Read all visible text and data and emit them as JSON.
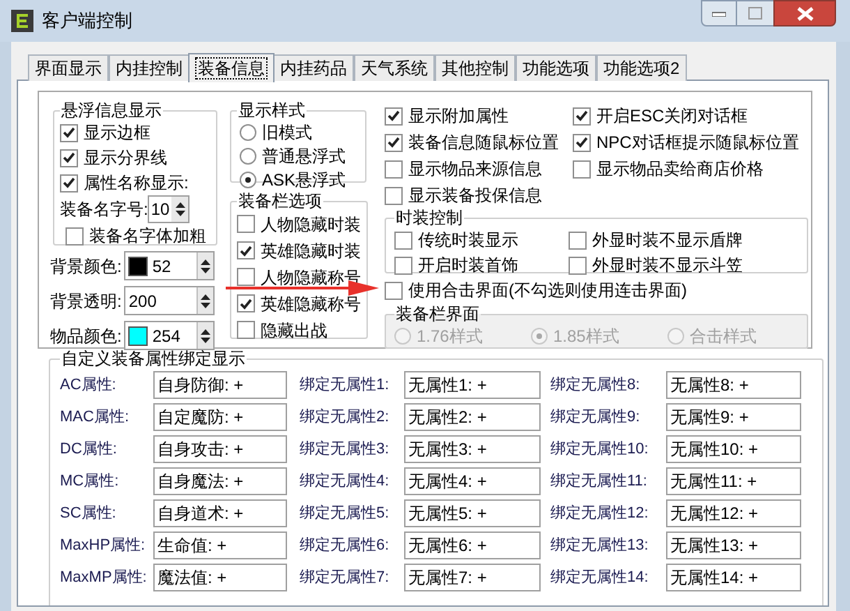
{
  "window": {
    "title": "客户端控制"
  },
  "tabs": [
    {
      "label": "界面显示",
      "selected": false
    },
    {
      "label": "内挂控制",
      "selected": false
    },
    {
      "label": "装备信息",
      "selected": true
    },
    {
      "label": "内挂药品",
      "selected": false
    },
    {
      "label": "天气系统",
      "selected": false
    },
    {
      "label": "其他控制",
      "selected": false
    },
    {
      "label": "功能选项",
      "selected": false
    },
    {
      "label": "功能选项2",
      "selected": false
    }
  ],
  "float_info": {
    "title": "悬浮信息显示",
    "checkboxes": [
      {
        "label": "显示边框",
        "checked": true
      },
      {
        "label": "显示分界线",
        "checked": true
      },
      {
        "label": "属性名称显示:",
        "checked": true
      }
    ],
    "font_size": {
      "label": "装备名字号:",
      "value": "10"
    },
    "bold": {
      "label": "装备名字体加粗",
      "checked": false
    }
  },
  "color_settings": [
    {
      "kind": "color",
      "label": "背景颜色:",
      "value": "52",
      "color": "#000000"
    },
    {
      "kind": "number",
      "label": "背景透明:",
      "value": "200"
    },
    {
      "kind": "color",
      "label": "物品颜色:",
      "value": "254",
      "color": "#00ffff"
    }
  ],
  "display_style": {
    "title": "显示样式",
    "options": [
      {
        "label": "旧模式",
        "selected": false
      },
      {
        "label": "普通悬浮式",
        "selected": false
      },
      {
        "label": "ASK悬浮式",
        "selected": true
      }
    ]
  },
  "equip_bar_options": {
    "title": "装备栏选项",
    "checkboxes": [
      {
        "label": "人物隐藏时装",
        "checked": false
      },
      {
        "label": "英雄隐藏时装",
        "checked": true
      },
      {
        "label": "人物隐藏称号",
        "checked": false
      },
      {
        "label": "英雄隐藏称号",
        "checked": true
      },
      {
        "label": "隐藏出战",
        "checked": false
      }
    ]
  },
  "options": [
    {
      "label": "显示附加属性",
      "checked": true
    },
    {
      "label": "开启ESC关闭对话框",
      "checked": true
    },
    {
      "label": "装备信息随鼠标位置",
      "checked": true
    },
    {
      "label": "NPC对话框提示随鼠标位置",
      "checked": true
    },
    {
      "label": "显示物品来源信息",
      "checked": false
    },
    {
      "label": "显示物品卖给商店价格",
      "checked": false
    },
    {
      "label": "显示装备投保信息",
      "checked": false
    }
  ],
  "fashion_control": {
    "title": "时装控制",
    "checkboxes": [
      {
        "label": "传统时装显示",
        "checked": false
      },
      {
        "label": "外显时装不显示盾牌",
        "checked": false
      },
      {
        "label": "开启时装首饰",
        "checked": false
      },
      {
        "label": "外显时装不显示斗笠",
        "checked": false
      }
    ]
  },
  "combo_ui": {
    "label": "使用合击界面(不勾选则使用连击界面)",
    "checked": false
  },
  "equip_bar_ui": {
    "title": "装备栏界面",
    "disabled": true,
    "options": [
      {
        "label": "1.76样式",
        "selected": false
      },
      {
        "label": "1.85样式",
        "selected": true
      },
      {
        "label": "合击样式",
        "selected": false
      }
    ]
  },
  "attribute_binding": {
    "title": "自定义装备属性绑定显示",
    "rows": [
      {
        "cells": [
          {
            "label": "AC属性:",
            "value": "自身防御: +"
          },
          {
            "label": "绑定无属性1:",
            "value": "无属性1: +"
          },
          {
            "label": "绑定无属性8:",
            "value": "无属性8: +"
          }
        ]
      },
      {
        "cells": [
          {
            "label": "MAC属性:",
            "value": "自定魔防: +"
          },
          {
            "label": "绑定无属性2:",
            "value": "无属性2: +"
          },
          {
            "label": "绑定无属性9:",
            "value": "无属性9: +"
          }
        ]
      },
      {
        "cells": [
          {
            "label": "DC属性:",
            "value": "自身攻击: +"
          },
          {
            "label": "绑定无属性3:",
            "value": "无属性3: +"
          },
          {
            "label": "绑定无属性10:",
            "value": "无属性10: +"
          }
        ]
      },
      {
        "cells": [
          {
            "label": "MC属性:",
            "value": "自身魔法: +"
          },
          {
            "label": "绑定无属性4:",
            "value": "无属性4: +"
          },
          {
            "label": "绑定无属性11:",
            "value": "无属性11: +"
          }
        ]
      },
      {
        "cells": [
          {
            "label": "SC属性:",
            "value": "自身道术: +"
          },
          {
            "label": "绑定无属性5:",
            "value": "无属性5: +"
          },
          {
            "label": "绑定无属性12:",
            "value": "无属性12: +"
          }
        ]
      },
      {
        "cells": [
          {
            "label": "MaxHP属性:",
            "value": "生命值: +"
          },
          {
            "label": "绑定无属性6:",
            "value": "无属性6: +"
          },
          {
            "label": "绑定无属性13:",
            "value": "无属性13: +"
          }
        ]
      },
      {
        "cells": [
          {
            "label": "MaxMP属性:",
            "value": "魔法值: +"
          },
          {
            "label": "绑定无属性7:",
            "value": "无属性7: +"
          },
          {
            "label": "绑定无属性14:",
            "value": "无属性14: +"
          }
        ]
      }
    ]
  }
}
